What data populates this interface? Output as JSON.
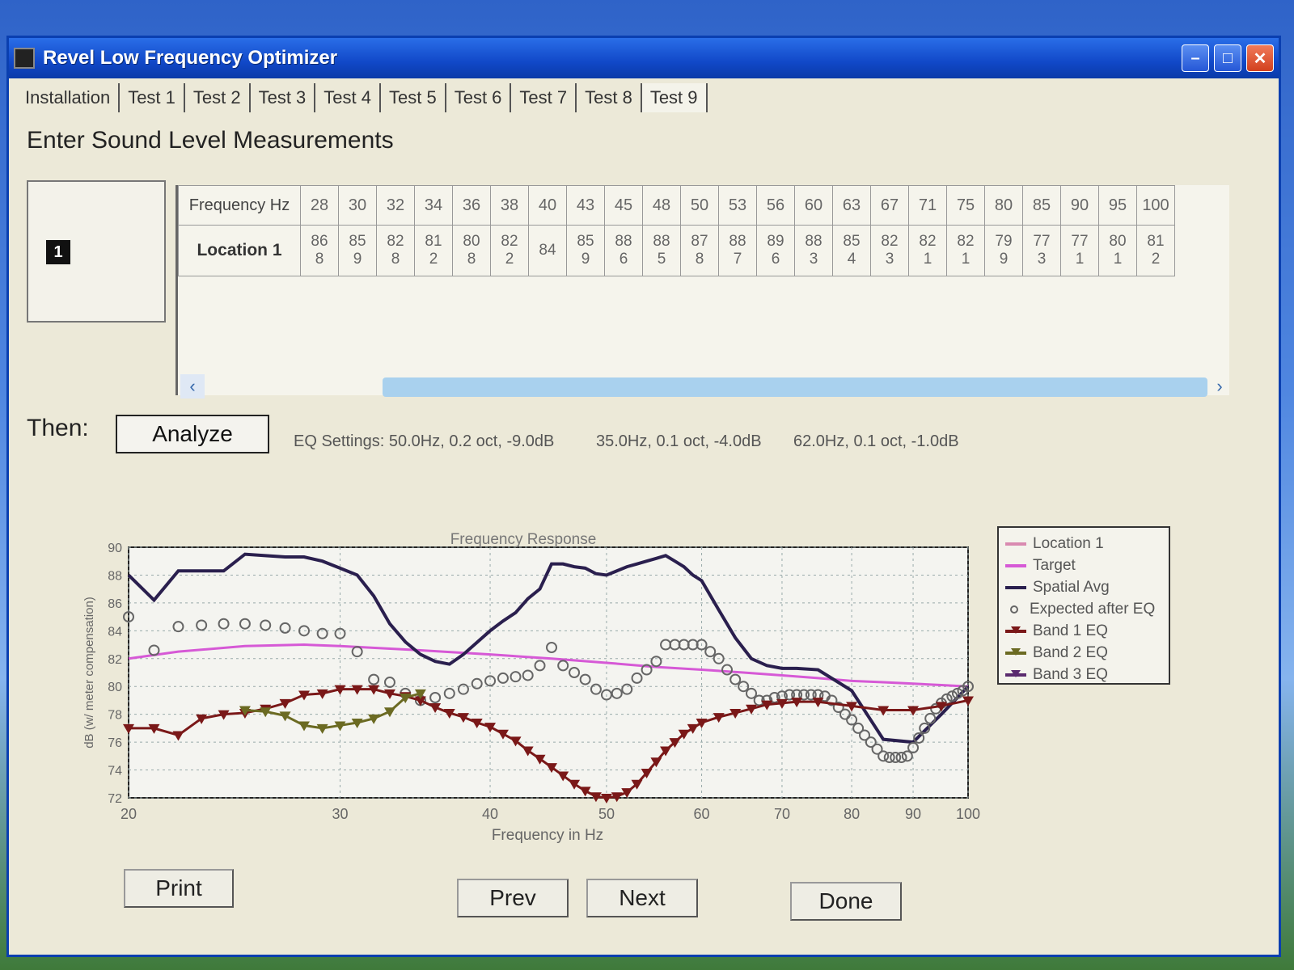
{
  "window": {
    "title": "Revel Low Frequency Optimizer"
  },
  "tabs": [
    {
      "label": "Installation"
    },
    {
      "label": "Test 1"
    },
    {
      "label": "Test 2"
    },
    {
      "label": "Test 3"
    },
    {
      "label": "Test 4"
    },
    {
      "label": "Test 5"
    },
    {
      "label": "Test 6"
    },
    {
      "label": "Test 7"
    },
    {
      "label": "Test 8"
    },
    {
      "label": "Test 9"
    }
  ],
  "page": {
    "title": "Enter Sound Level Measurements"
  },
  "location_badge": "1",
  "measurements": {
    "header_label": "Frequency Hz",
    "row_label": "Location 1",
    "frequencies": [
      "28",
      "30",
      "32",
      "34",
      "36",
      "38",
      "40",
      "43",
      "45",
      "48",
      "50",
      "53",
      "56",
      "60",
      "63",
      "67",
      "71",
      "75",
      "80",
      "85",
      "90",
      "95",
      "100"
    ],
    "values": [
      [
        "86",
        "8"
      ],
      [
        "85",
        "9"
      ],
      [
        "82",
        "8"
      ],
      [
        "81",
        "2"
      ],
      [
        "80",
        "8"
      ],
      [
        "82",
        "2"
      ],
      [
        "84",
        ""
      ],
      [
        "85",
        "9"
      ],
      [
        "88",
        "6"
      ],
      [
        "88",
        "5"
      ],
      [
        "87",
        "8"
      ],
      [
        "88",
        "7"
      ],
      [
        "89",
        "6"
      ],
      [
        "88",
        "3"
      ],
      [
        "85",
        "4"
      ],
      [
        "82",
        "3"
      ],
      [
        "82",
        "1"
      ],
      [
        "82",
        "1"
      ],
      [
        "79",
        "9"
      ],
      [
        "77",
        "3"
      ],
      [
        "77",
        "1"
      ],
      [
        "80",
        "1"
      ],
      [
        "81",
        "2"
      ]
    ]
  },
  "actions": {
    "then_label": "Then:",
    "analyze_label": "Analyze",
    "eq_settings": [
      "EQ Settings: 50.0Hz, 0.2 oct, -9.0dB",
      "35.0Hz, 0.1 oct, -4.0dB",
      "62.0Hz, 0.1 oct, -1.0dB"
    ]
  },
  "chart_data": {
    "type": "line",
    "title": "Frequency Response",
    "xlabel": "Frequency in Hz",
    "ylabel": "dB (w/ meter compensation)",
    "x_scale": "log",
    "xlim": [
      20,
      100
    ],
    "ylim": [
      72,
      90
    ],
    "x_ticks": [
      "20",
      "30",
      "40",
      "50",
      "60",
      "70",
      "80",
      "90",
      "100"
    ],
    "y_ticks": [
      "72",
      "74",
      "76",
      "78",
      "80",
      "82",
      "84",
      "86",
      "88",
      "90"
    ],
    "grid": true,
    "legend_position": "right",
    "series": [
      {
        "name": "Location 1",
        "color": "#d98ab0",
        "style": "line",
        "x": [],
        "y": []
      },
      {
        "name": "Target",
        "color": "#d659d6",
        "style": "line",
        "x": [
          20,
          22,
          25,
          28,
          30,
          35,
          40,
          45,
          50,
          55,
          60,
          65,
          70,
          75,
          80,
          85,
          90,
          95,
          100
        ],
        "y": [
          82,
          82.5,
          82.9,
          83,
          82.9,
          82.6,
          82.3,
          82,
          81.7,
          81.4,
          81.2,
          81,
          80.8,
          80.6,
          80.4,
          80.3,
          80.2,
          80.1,
          80
        ]
      },
      {
        "name": "Spatial Avg",
        "color": "#2a1f4e",
        "style": "line",
        "x": [
          20,
          21,
          22,
          23,
          24,
          25,
          26,
          27,
          28,
          29,
          30,
          31,
          32,
          33,
          34,
          35,
          36,
          37,
          38,
          40,
          41,
          42,
          43,
          44,
          45,
          46,
          47,
          48,
          49,
          50,
          51,
          52,
          53,
          54,
          55,
          56,
          57,
          58,
          59,
          60,
          62,
          64,
          66,
          68,
          70,
          72,
          75,
          80,
          85,
          90,
          95,
          100
        ],
        "y": [
          88,
          86.2,
          88.3,
          88.3,
          88.3,
          89.5,
          89.4,
          89.3,
          89.3,
          89,
          88.5,
          88,
          86.5,
          84.5,
          83.2,
          82.3,
          81.8,
          81.6,
          82.3,
          84,
          84.7,
          85.3,
          86.3,
          87,
          88.8,
          88.8,
          88.6,
          88.5,
          88.1,
          88,
          88.3,
          88.6,
          88.8,
          89,
          89.2,
          89.4,
          89,
          88.6,
          88,
          87.6,
          85.5,
          83.5,
          82,
          81.5,
          81.3,
          81.3,
          81.2,
          79.7,
          76.2,
          76,
          78,
          80
        ]
      },
      {
        "name": "Expected after EQ",
        "color": "#666666",
        "style": "circles",
        "x": [
          20,
          21,
          22,
          23,
          24,
          25,
          26,
          27,
          28,
          29,
          30,
          31,
          32,
          33,
          34,
          35,
          36,
          37,
          38,
          39,
          40,
          41,
          42,
          43,
          44,
          45,
          46,
          47,
          48,
          49,
          50,
          51,
          52,
          53,
          54,
          55,
          56,
          57,
          58,
          59,
          60,
          61,
          62,
          63,
          64,
          65,
          66,
          67,
          68,
          69,
          70,
          71,
          72,
          73,
          74,
          75,
          76,
          77,
          78,
          79,
          80,
          81,
          82,
          83,
          84,
          85,
          86,
          87,
          88,
          89,
          90,
          91,
          92,
          93,
          94,
          95,
          96,
          97,
          98,
          99,
          100
        ],
        "y": [
          85,
          82.6,
          84.3,
          84.4,
          84.5,
          84.5,
          84.4,
          84.2,
          84,
          83.8,
          83.8,
          82.5,
          80.5,
          80.3,
          79.5,
          79,
          79.2,
          79.5,
          79.8,
          80.2,
          80.4,
          80.6,
          80.7,
          80.8,
          81.5,
          82.8,
          81.5,
          81,
          80.5,
          79.8,
          79.4,
          79.5,
          79.8,
          80.6,
          81.2,
          81.8,
          83,
          83,
          83,
          83,
          83,
          82.5,
          82,
          81.2,
          80.5,
          80,
          79.5,
          79,
          79,
          79.2,
          79.3,
          79.4,
          79.4,
          79.4,
          79.4,
          79.4,
          79.3,
          79,
          78.5,
          78,
          77.6,
          77,
          76.5,
          76,
          75.5,
          75,
          74.9,
          74.9,
          74.9,
          75,
          75.6,
          76.3,
          77,
          77.7,
          78.4,
          78.8,
          79.1,
          79.3,
          79.5,
          79.7,
          80
        ]
      },
      {
        "name": "Band 1 EQ",
        "color": "#7a1818",
        "style": "triangles",
        "x": [
          20,
          21,
          22,
          23,
          24,
          25,
          26,
          27,
          28,
          29,
          30,
          31,
          32,
          33,
          34,
          35,
          36,
          37,
          38,
          39,
          40,
          41,
          42,
          43,
          44,
          45,
          46,
          47,
          48,
          49,
          50,
          51,
          52,
          53,
          54,
          55,
          56,
          57,
          58,
          59,
          60,
          62,
          64,
          66,
          68,
          70,
          72,
          75,
          80,
          85,
          90,
          95,
          100
        ],
        "y": [
          77,
          77,
          76.5,
          77.7,
          78,
          78.1,
          78.4,
          78.8,
          79.4,
          79.5,
          79.8,
          79.8,
          79.8,
          79.5,
          79.3,
          79,
          78.5,
          78.1,
          77.8,
          77.4,
          77.1,
          76.6,
          76.1,
          75.4,
          74.8,
          74.2,
          73.6,
          73,
          72.5,
          72.1,
          72,
          72.1,
          72.4,
          73,
          73.8,
          74.6,
          75.4,
          76,
          76.6,
          77,
          77.4,
          77.8,
          78.1,
          78.4,
          78.7,
          78.8,
          78.9,
          78.9,
          78.6,
          78.3,
          78.3,
          78.6,
          79
        ]
      },
      {
        "name": "Band 2 EQ",
        "color": "#6b6a22",
        "style": "triangles",
        "x": [
          25,
          26,
          27,
          28,
          29,
          30,
          31,
          32,
          33,
          34,
          35
        ],
        "y": [
          78.3,
          78.2,
          77.9,
          77.2,
          77,
          77.2,
          77.4,
          77.7,
          78.2,
          79.2,
          79.5
        ]
      },
      {
        "name": "Band 3 EQ",
        "color": "#5a2a6e",
        "style": "triangles",
        "x": [],
        "y": []
      }
    ]
  },
  "buttons": {
    "print": "Print",
    "prev": "Prev",
    "next": "Next",
    "done": "Done"
  }
}
